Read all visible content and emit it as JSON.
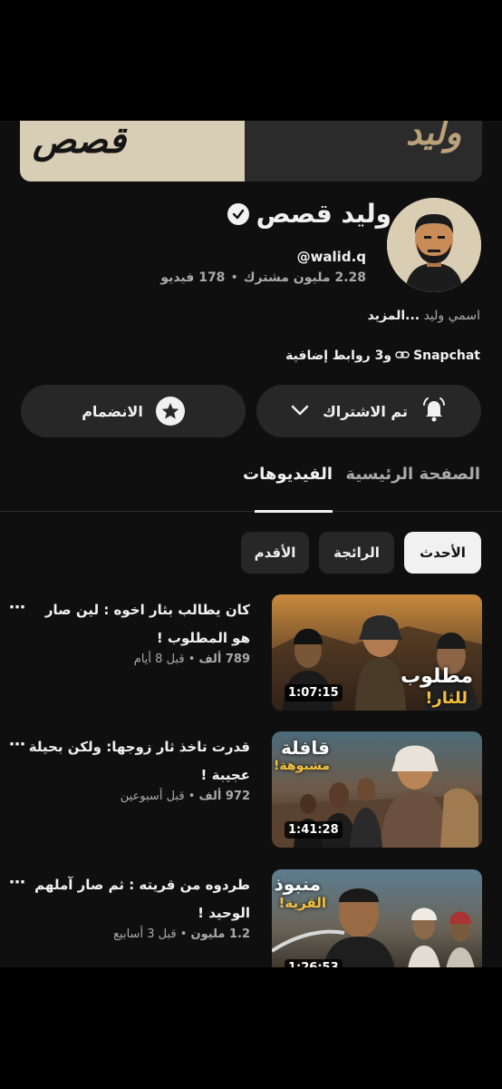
{
  "banner": {
    "script_left": "قصص",
    "script_right": "وليد"
  },
  "channel": {
    "name": "وليد قصص",
    "handle": "@walid.q",
    "subscribers": "2.28 مليون مشترك",
    "separator": "•",
    "videos_count": "178 فيديو",
    "description": "اسمي وليد",
    "more": "...المزيد",
    "link_name": "Snapchat",
    "extra_links": "و3 روابط إضافية"
  },
  "actions": {
    "subscribed_label": "تم الاشتراك",
    "join_label": "الانضمام"
  },
  "tabs": [
    {
      "label": "الصفحة الرئيسية",
      "active": false
    },
    {
      "label": "الفيديوهات",
      "active": true
    }
  ],
  "chips": [
    {
      "label": "الأحدث",
      "selected": true
    },
    {
      "label": "الرائجة",
      "selected": false
    },
    {
      "label": "الأقدم",
      "selected": false
    }
  ],
  "videos": [
    {
      "title": "كان يطالب بثار اخوه : لين صار هو المطلوب !",
      "views": "789 ألف",
      "age": "قبل 8 أيام",
      "duration": "1:07:15",
      "thumb_line1": "مطلوب",
      "thumb_line2": "للثار!"
    },
    {
      "title": "قدرت تاخذ ثار زوجها: ولكن بحيلة عجيبة !",
      "views": "972 ألف",
      "age": "قبل أسبوعين",
      "duration": "1:41:28",
      "thumb_line1": "قافلة",
      "thumb_line2": "مشبوهة!"
    },
    {
      "title": "طردوه من قريته : ثم صار آملهم الوحيد !",
      "views": "1.2 مليون",
      "age": "قبل 3 أسابيع",
      "duration": "1:26:53",
      "thumb_line1": "منبوذ",
      "thumb_line2": "القرية!"
    }
  ],
  "more_icon": "⋯",
  "colors": {
    "background": "#0f0f0f",
    "surface": "#272727",
    "text_primary": "#f1f1f1",
    "text_secondary": "#aaaaaa",
    "chip_selected_bg": "#f1f1f1"
  }
}
